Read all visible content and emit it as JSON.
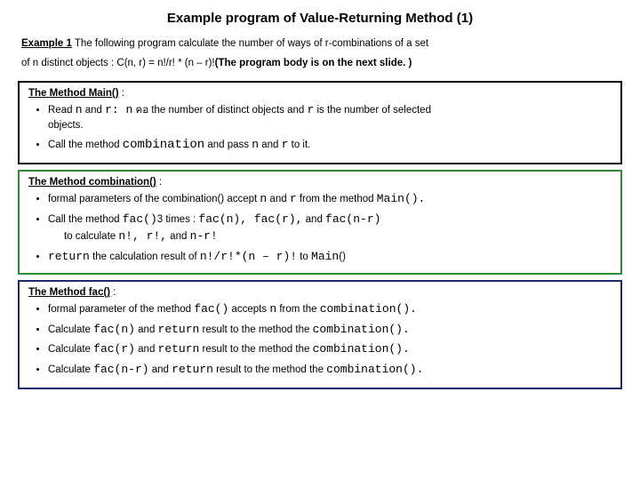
{
  "title": "Example program of Value-Returning Method (1)",
  "intro": {
    "lead": "Example 1",
    "rest1": " The following program calculate the number of ways of r-combinations of a set",
    "rest2": "of n distinct objects :   C(n, r) = n!/r! * (n – r)!",
    "bold_tail": "(The program body is on the next slide. )"
  },
  "main_box": {
    "heading": "The Method Main()",
    "b1_a": "Read ",
    "b1_n": "n",
    "b1_b": " and ",
    "b1_r": "r",
    "b1_c": ":",
    "b1_na": " n",
    "b1_thai": " คอ ",
    "b1_d": " the number of distinct objects and ",
    "b1_r2": "r",
    "b1_e": " is the number of selected",
    "b1_f": "objects.",
    "b2_a": "Call the method ",
    "b2_m": "combination",
    "b2_b": " and pass ",
    "b2_n": "n",
    "b2_c": " and ",
    "b2_r": "r",
    "b2_d": " to it."
  },
  "comb_box": {
    "heading": "The Method combination()",
    "b1_a": "formal parameters of the combination() accept ",
    "b1_n": "n",
    "b1_b": " and ",
    "b1_r": "r",
    "b1_c": " from the method ",
    "b1_m": "Main().",
    "b2_a": "Call the method ",
    "b2_m": "fac()",
    "b2_b": "3 times : ",
    "b2_calls": "fac(n), fac(r),",
    "b2_c": " and ",
    "b2_last": "fac(n-r)",
    "b2_d": "to calculate  ",
    "b2_exp": "n!, r!,",
    "b2_e": " and ",
    "b2_exp2": "n-r!",
    "b3_ret": " return",
    "b3_a": " the calculation result of  ",
    "b3_exp": "n!/r!*(n – r)!",
    "b3_b": " to ",
    "b3_m": "Main",
    "b3_paren": "()"
  },
  "fac_box": {
    "heading": "The Method fac()",
    "b1_a": "formal parameter of the method ",
    "b1_f": "fac()",
    "b1_b": " accepts  ",
    "b1_n": "n",
    "b1_c": "  from the ",
    "b1_m": "combination().",
    "b2_a": "Calculate ",
    "b2_f": "fac(n)",
    "b2_b": " and ",
    "b2_ret": "return",
    "b2_c": " result to the method the ",
    "b2_m": "combination().",
    "b3_a": "Calculate ",
    "b3_f": "fac(r)",
    "b3_b": " and ",
    "b3_ret": "return",
    "b3_c": " result to the method the ",
    "b3_m": "combination().",
    "b4_a": "Calculate ",
    "b4_f": "fac(n-r)",
    "b4_b": " and ",
    "b4_ret": "return",
    "b4_c": " result to the method the ",
    "b4_m": "combination()."
  },
  "colon": "  :"
}
